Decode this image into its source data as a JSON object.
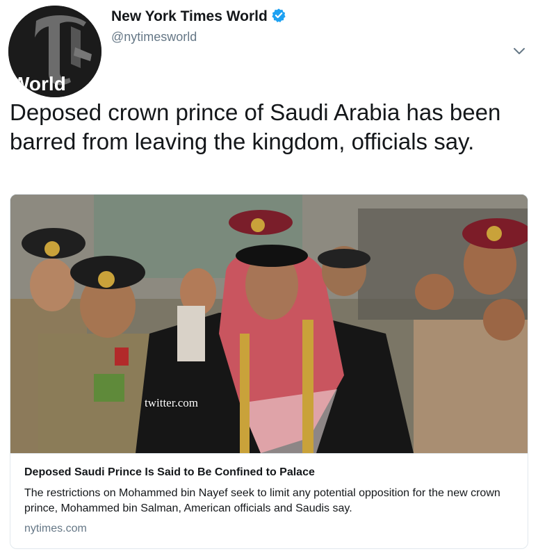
{
  "author": {
    "name": "New York Times World",
    "handle": "@nytimesworld",
    "avatar_text": "World"
  },
  "tweet": {
    "text": "Deposed crown prince of Saudi Arabia has been barred from leaving the kingdom, officials say."
  },
  "card": {
    "title": "Deposed Saudi Prince Is Said to Be Confined to Palace",
    "description": "The restrictions on Mohammed bin Nayef seek to limit any potential opposition for the new crown prince, Mohammed bin Salman, American officials and Saudis say.",
    "domain": "nytimes.com",
    "image_watermark": "twitter.com"
  },
  "icons": {
    "verified": "verified-badge-icon",
    "caret": "chevron-down-icon"
  },
  "colors": {
    "verified_blue": "#1da1f2",
    "secondary_text": "#657786",
    "border": "#e1e8ed"
  }
}
